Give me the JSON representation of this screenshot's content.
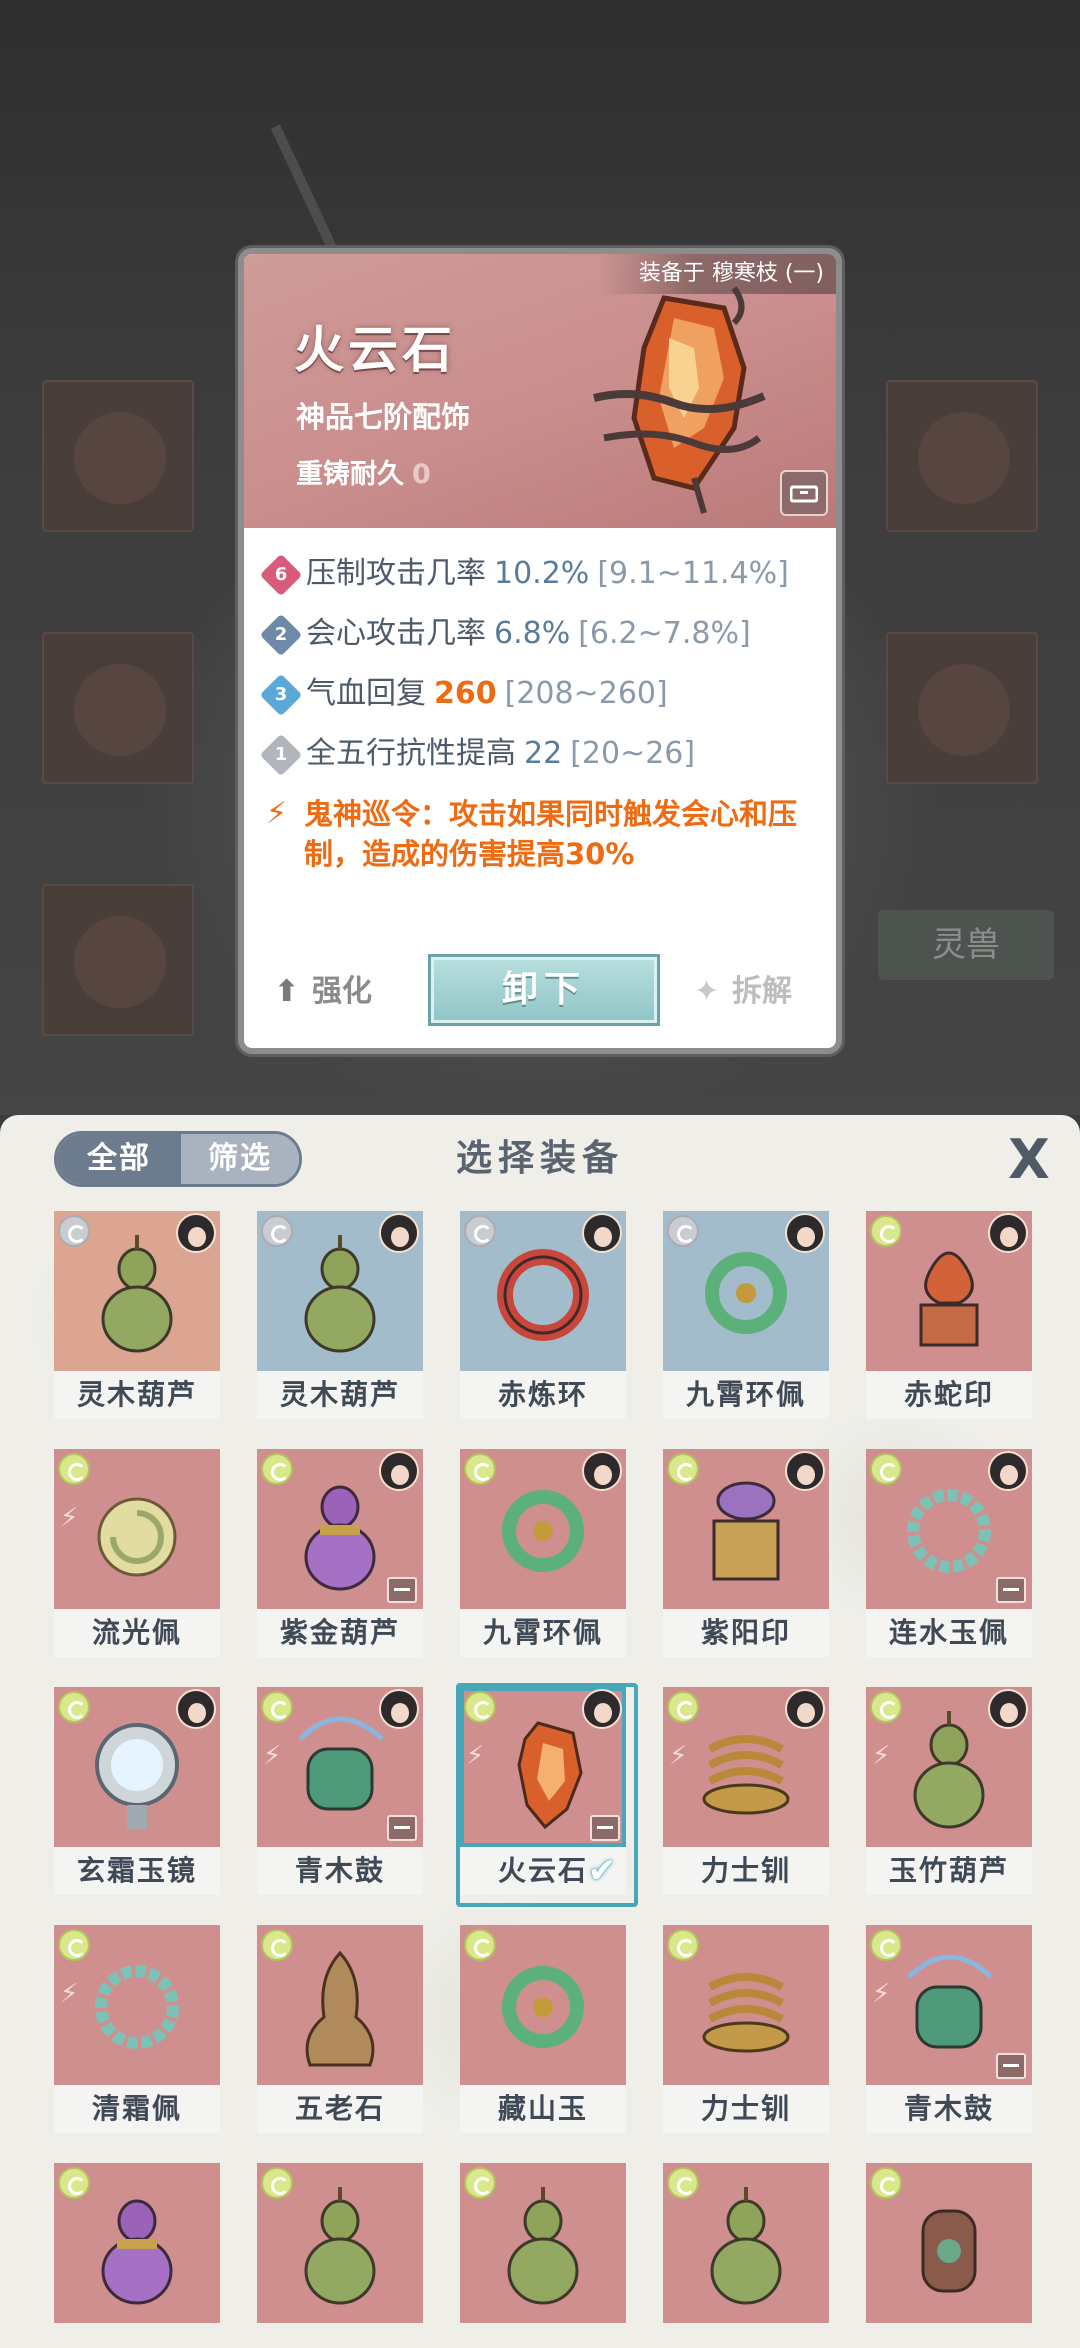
{
  "detail": {
    "equipped_on": "装备于 穆寒枝 (一)",
    "name": "火云石",
    "grade": "神品七阶配饰",
    "reforge_label": "重铸耐久",
    "reforge_value": "0",
    "stats": [
      {
        "badge": "6",
        "label": "压制攻击几率",
        "value": "10.2%",
        "range": "[9.1~11.4%]",
        "badge_color": "#d95a7a"
      },
      {
        "badge": "2",
        "label": "会心攻击几率",
        "value": "6.8%",
        "range": "[6.2~7.8%]",
        "badge_color": "#6f8aa8"
      },
      {
        "badge": "3",
        "label": "气血回复",
        "value": "260",
        "range": "[208~260]",
        "badge_color": "#5aa8d8"
      },
      {
        "badge": "1",
        "label": "全五行抗性提高",
        "value": "22",
        "range": "[20~26]",
        "badge_color": "#b0b6bc"
      }
    ],
    "special_effect": "鬼神巡令：攻击如果同时触发会心和压制，造成的伤害提高30%",
    "enhance_label": "强化",
    "unequip_label": "卸下",
    "dismantle_label": "拆解"
  },
  "background": {
    "pet_label": "灵兽"
  },
  "panel": {
    "tab_all": "全部",
    "tab_filter": "筛选",
    "title": "选择装备",
    "close_symbol": "X"
  },
  "items": [
    {
      "name": "灵木葫芦",
      "tile": "peach",
      "tag": "gray",
      "owner": true,
      "pin": false,
      "lock": false,
      "selected": false,
      "art": "gourd-green"
    },
    {
      "name": "灵木葫芦",
      "tile": "blue",
      "tag": "gray",
      "owner": true,
      "pin": false,
      "lock": false,
      "selected": false,
      "art": "gourd-green"
    },
    {
      "name": "赤炼环",
      "tile": "blue",
      "tag": "gray",
      "owner": true,
      "pin": false,
      "lock": false,
      "selected": false,
      "art": "ring-red"
    },
    {
      "name": "九霄环佩",
      "tile": "blue",
      "tag": "gray",
      "owner": true,
      "pin": false,
      "lock": false,
      "selected": false,
      "art": "ring-green"
    },
    {
      "name": "赤蛇印",
      "tile": "red",
      "tag": "green",
      "owner": true,
      "pin": false,
      "lock": false,
      "selected": false,
      "art": "seal-red"
    },
    {
      "name": "流光佩",
      "tile": "red",
      "tag": "green",
      "owner": false,
      "pin": true,
      "lock": false,
      "selected": false,
      "art": "disc-yellow"
    },
    {
      "name": "紫金葫芦",
      "tile": "red",
      "tag": "green",
      "owner": true,
      "pin": false,
      "lock": true,
      "selected": false,
      "art": "gourd-purple"
    },
    {
      "name": "九霄环佩",
      "tile": "red",
      "tag": "green",
      "owner": true,
      "pin": false,
      "lock": false,
      "selected": false,
      "art": "ring-green"
    },
    {
      "name": "紫阳印",
      "tile": "red",
      "tag": "green",
      "owner": true,
      "pin": false,
      "lock": false,
      "selected": false,
      "art": "seal-purple"
    },
    {
      "name": "连水玉佩",
      "tile": "red",
      "tag": "green",
      "owner": true,
      "pin": false,
      "lock": true,
      "selected": false,
      "art": "ring-teal"
    },
    {
      "name": "玄霜玉镜",
      "tile": "red",
      "tag": "green",
      "owner": true,
      "pin": false,
      "lock": false,
      "selected": false,
      "art": "mirror"
    },
    {
      "name": "青木鼓",
      "tile": "red",
      "tag": "green",
      "owner": true,
      "pin": true,
      "lock": true,
      "selected": false,
      "art": "drum"
    },
    {
      "name": "火云石",
      "tile": "red",
      "tag": "green",
      "owner": true,
      "pin": true,
      "lock": true,
      "selected": true,
      "art": "fire-stone"
    },
    {
      "name": "力士钏",
      "tile": "red",
      "tag": "green",
      "owner": true,
      "pin": true,
      "lock": false,
      "selected": false,
      "art": "bracelet"
    },
    {
      "name": "玉竹葫芦",
      "tile": "red",
      "tag": "green",
      "owner": true,
      "pin": true,
      "lock": false,
      "selected": false,
      "art": "gourd-green"
    },
    {
      "name": "清霜佩",
      "tile": "red",
      "tag": "green",
      "owner": false,
      "pin": true,
      "lock": false,
      "selected": false,
      "art": "ring-teal"
    },
    {
      "name": "五老石",
      "tile": "red",
      "tag": "green",
      "owner": false,
      "pin": false,
      "lock": false,
      "selected": false,
      "art": "stone"
    },
    {
      "name": "藏山玉",
      "tile": "red",
      "tag": "green",
      "owner": false,
      "pin": false,
      "lock": false,
      "selected": false,
      "art": "ring-green"
    },
    {
      "name": "力士钏",
      "tile": "red",
      "tag": "green",
      "owner": false,
      "pin": false,
      "lock": false,
      "selected": false,
      "art": "bracelet"
    },
    {
      "name": "青木鼓",
      "tile": "red",
      "tag": "green",
      "owner": false,
      "pin": true,
      "lock": true,
      "selected": false,
      "art": "drum"
    },
    {
      "name": "",
      "tile": "red",
      "tag": "green",
      "owner": false,
      "pin": false,
      "lock": false,
      "selected": false,
      "art": "gourd-purple"
    },
    {
      "name": "",
      "tile": "red",
      "tag": "green",
      "owner": false,
      "pin": false,
      "lock": false,
      "selected": false,
      "art": "gourd-green"
    },
    {
      "name": "",
      "tile": "red",
      "tag": "green",
      "owner": false,
      "pin": false,
      "lock": false,
      "selected": false,
      "art": "gourd-green"
    },
    {
      "name": "",
      "tile": "red",
      "tag": "green",
      "owner": false,
      "pin": false,
      "lock": false,
      "selected": false,
      "art": "gourd-green"
    },
    {
      "name": "",
      "tile": "red",
      "tag": "green",
      "owner": false,
      "pin": false,
      "lock": false,
      "selected": false,
      "art": "lantern"
    }
  ]
}
